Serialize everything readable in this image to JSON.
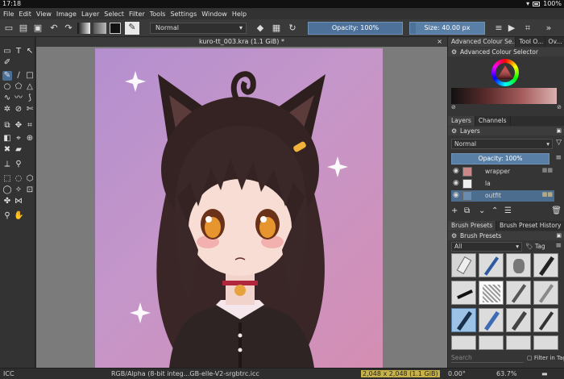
{
  "status": {
    "time": "17:18",
    "battery": "100%"
  },
  "menu": [
    "File",
    "Edit",
    "View",
    "Image",
    "Layer",
    "Select",
    "Filter",
    "Tools",
    "Settings",
    "Window",
    "Help"
  ],
  "options": {
    "blend_mode": "Normal",
    "opacity": "Opacity: 100%",
    "opacity_level": 1.0,
    "size": "Size: 40.00 px",
    "size_level": 0.08
  },
  "document": {
    "title": "kuro-tt_003.kra (1.1 GiB)",
    "modified": "*"
  },
  "dock": {
    "top_tabs": [
      "Advanced Colour Se...",
      "Tool O...",
      "Ov..."
    ],
    "colour_selector_title": "Advanced Colour Selector",
    "layers_tabs": [
      "Layers",
      "Channels"
    ],
    "layers_title": "Layers",
    "layer_blend": "Normal",
    "layer_opacity": "Opacity:  100%",
    "layers": [
      {
        "name": "wrapper"
      },
      {
        "name": "la"
      },
      {
        "name": "outfit"
      }
    ],
    "preset_tabs": [
      "Brush Presets",
      "Brush Preset History"
    ],
    "presets_title": "Brush Presets",
    "preset_filter": "All",
    "tag_label": "Tag",
    "search_placeholder": "Search",
    "filter_in_tag": "Filter in Tag"
  },
  "bottom": {
    "color_profile": "RGB/Alpha (8-bit integ...GB-elle-V2-srgbtrc.icc",
    "image_size": "2,048 x 2,048 (1.1 GiB)",
    "rotation": "0.00°",
    "zoom": "63.7%",
    "icc_label": "ICC"
  },
  "colors": {
    "accent": "#5a7fa6",
    "canvas_bg": "#7b7b7b",
    "artwork_bg": "#c596c9"
  }
}
